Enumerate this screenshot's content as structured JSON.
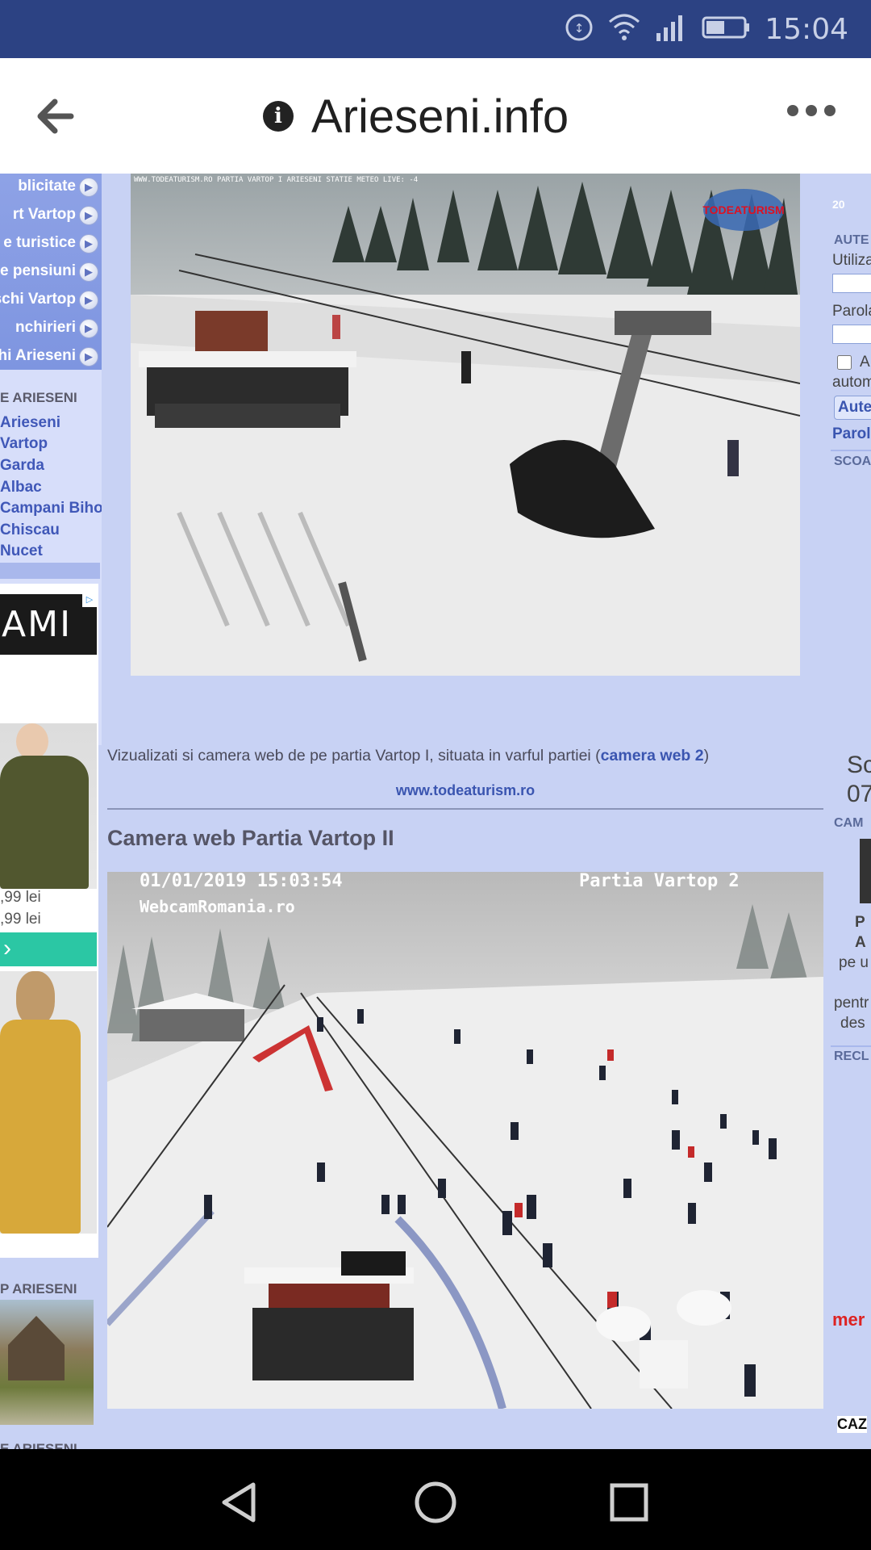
{
  "status_bar": {
    "time": "15:04",
    "icons": [
      "data-saver-icon",
      "wifi-icon",
      "signal-icon",
      "battery-icon"
    ]
  },
  "browser": {
    "url": "Arieseni.info",
    "back_icon": "back-arrow-icon",
    "info_icon": "info-icon",
    "menu_icon": "more-menu-icon"
  },
  "left_column": {
    "nav_items": [
      {
        "label": "blicitate"
      },
      {
        "label": "rt Vartop"
      },
      {
        "label": "e turistice"
      },
      {
        "label": "re pensiuni"
      },
      {
        "label": " schi Vartop"
      },
      {
        "label": "nchirieri"
      },
      {
        "label": "chi Arieseni"
      }
    ],
    "locations_title": "E ARIESENI",
    "locations": [
      "Arieseni",
      "Vartop",
      "Garda",
      "Albac",
      "Campani Bihor",
      "Chiscau",
      "Nucet"
    ],
    "ad_brand": "AMI",
    "prices": [
      ",99 lei",
      ",99 lei"
    ],
    "cta": "›",
    "bottom_title": "P ARIESENI",
    "bottom_title2": "E ARIESENI"
  },
  "main": {
    "caption_prefix": "Vizualizati si camera web de pe partia Vartop I, situata in varful partiei (",
    "caption_link": "camera web 2",
    "caption_suffix": ")",
    "site_link": "www.todeaturism.ro",
    "cam2_title": "Camera web Partia Vartop II",
    "cam1_overlay": "WWW.TODEATURISM.RO PARTIA VARTOP I ARIESENI STATIE METEO LIVE: -4",
    "cam1_logo": "TODEATURISM",
    "cam2_timestamp": "01/01/2019 15:03:54",
    "cam2_site": "WebcamRomania.ro",
    "cam2_label": "Partia Vartop 2"
  },
  "right_column": {
    "auth_title": "AUTE",
    "user_label": "Utiliza",
    "pass_label": "Parola",
    "remember_label": "A",
    "remember_label2": "autom",
    "login_btn": "Aute",
    "forgot_link": "Parol",
    "school_title": "SCOA",
    "sc_text1": "Sc",
    "sc_text2": "07",
    "cam_title": "CAM",
    "cam_text1": "P",
    "cam_text2": "A",
    "cam_text3": "pe u",
    "cam_text4": "pentr",
    "cam_text5": "des",
    "recl_title": "RECL",
    "recl_text": "mer",
    "caz_text": "CAZ",
    "year_badge": "20"
  },
  "colors": {
    "status_bar": "#2c4283",
    "page_bg": "#c8d2f4",
    "link": "#3a55b0",
    "nav_box": "#8ea2e6"
  }
}
